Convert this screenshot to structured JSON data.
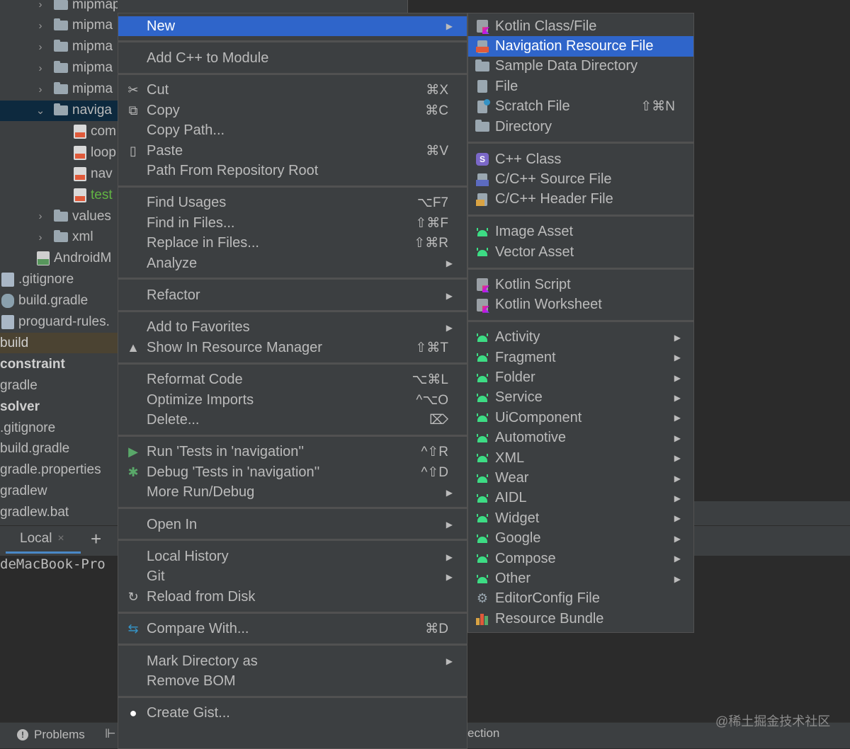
{
  "project_tree": {
    "items": [
      {
        "label": "mipmap-hdpi",
        "kind": "folder",
        "indent": 1,
        "chevron": "›"
      },
      {
        "label": "mipma",
        "kind": "folder",
        "indent": 1,
        "chevron": "›"
      },
      {
        "label": "mipma",
        "kind": "folder",
        "indent": 1,
        "chevron": "›"
      },
      {
        "label": "mipma",
        "kind": "folder",
        "indent": 1,
        "chevron": "›"
      },
      {
        "label": "mipma",
        "kind": "folder",
        "indent": 1,
        "chevron": "›"
      },
      {
        "label": "naviga",
        "kind": "folder",
        "indent": 1,
        "chevron": "⌄",
        "selected": true
      },
      {
        "label": "com",
        "kind": "xml",
        "indent": 2
      },
      {
        "label": "loop",
        "kind": "xml",
        "indent": 2
      },
      {
        "label": "nav",
        "kind": "xml",
        "indent": 2
      },
      {
        "label": "test",
        "kind": "xml",
        "indent": 2,
        "green": true
      },
      {
        "label": "values",
        "kind": "folder",
        "indent": 1,
        "chevron": "›"
      },
      {
        "label": "xml",
        "kind": "folder",
        "indent": 1,
        "chevron": "›"
      },
      {
        "label": "AndroidM",
        "kind": "mf",
        "indent": 3
      },
      {
        "label": ".gitignore",
        "kind": "plain",
        "indent": 0
      },
      {
        "label": "build.gradle",
        "kind": "gradle",
        "indent": 0
      },
      {
        "label": "proguard-rules.",
        "kind": "plain",
        "indent": 0
      },
      {
        "label": "build",
        "kind": "none",
        "indent": -1,
        "build": true
      },
      {
        "label": "constraint",
        "kind": "none",
        "indent": -1,
        "bold": true
      },
      {
        "label": "gradle",
        "kind": "none",
        "indent": -1
      },
      {
        "label": "solver",
        "kind": "none",
        "indent": -1,
        "bold": true
      },
      {
        "label": ".gitignore",
        "kind": "none",
        "indent": -1
      },
      {
        "label": "build.gradle",
        "kind": "none",
        "indent": -1
      },
      {
        "label": "gradle.properties",
        "kind": "none",
        "indent": -1
      },
      {
        "label": "gradlew",
        "kind": "none",
        "indent": -1
      },
      {
        "label": "gradlew.bat",
        "kind": "none",
        "indent": -1
      }
    ]
  },
  "terminal": {
    "tab_label": "Local",
    "close_glyph": "×",
    "add_glyph": "+",
    "prompt_text": "deMacBook-Pro"
  },
  "status_bar": {
    "problems_label": "Problems",
    "problems_icon": "!",
    "separator": "⊩",
    "right_text": "ection"
  },
  "watermark": "@稀土掘金技术社区",
  "context_menu": {
    "items": [
      {
        "label": "New",
        "arrow": "▶",
        "highlighted": true
      },
      {
        "sep": true
      },
      {
        "label": "Add C++ to Module"
      },
      {
        "sep": true
      },
      {
        "label": "Cut",
        "shortcut": "⌘X",
        "icon": "✂",
        "icon_name": "scissors-icon"
      },
      {
        "label": "Copy",
        "shortcut": "⌘C",
        "icon": "⧉",
        "icon_name": "copy-icon"
      },
      {
        "label": "Copy Path..."
      },
      {
        "label": "Paste",
        "shortcut": "⌘V",
        "icon": "▯",
        "icon_name": "clipboard-icon"
      },
      {
        "label": "Path From Repository Root"
      },
      {
        "sep": true
      },
      {
        "label": "Find Usages",
        "shortcut": "⌥F7"
      },
      {
        "label": "Find in Files...",
        "shortcut": "⇧⌘F"
      },
      {
        "label": "Replace in Files...",
        "shortcut": "⇧⌘R"
      },
      {
        "label": "Analyze",
        "arrow": "▶"
      },
      {
        "sep": true
      },
      {
        "label": "Refactor",
        "arrow": "▶"
      },
      {
        "sep": true
      },
      {
        "label": "Add to Favorites",
        "arrow": "▶"
      },
      {
        "label": "Show In Resource Manager",
        "shortcut": "⇧⌘T",
        "icon": "▲",
        "icon_name": "resource-manager-icon"
      },
      {
        "sep": true
      },
      {
        "label": "Reformat Code",
        "shortcut": "⌥⌘L"
      },
      {
        "label": "Optimize Imports",
        "shortcut": "^⌥O"
      },
      {
        "label": "Delete...",
        "shortcut": "⌦"
      },
      {
        "sep": true
      },
      {
        "label": "Run 'Tests in 'navigation''",
        "shortcut": "^⇧R",
        "icon": "▶",
        "icon_name": "run-icon",
        "icon_color": "#59a869"
      },
      {
        "label": "Debug 'Tests in 'navigation''",
        "shortcut": "^⇧D",
        "icon": "✱",
        "icon_name": "debug-icon",
        "icon_color": "#59a869"
      },
      {
        "label": "More Run/Debug",
        "arrow": "▶"
      },
      {
        "sep": true
      },
      {
        "label": "Open In",
        "arrow": "▶"
      },
      {
        "sep": true
      },
      {
        "label": "Local History",
        "arrow": "▶"
      },
      {
        "label": "Git",
        "arrow": "▶"
      },
      {
        "label": "Reload from Disk",
        "icon": "↻",
        "icon_name": "reload-icon"
      },
      {
        "sep": true
      },
      {
        "label": "Compare With...",
        "shortcut": "⌘D",
        "icon": "⇆",
        "icon_name": "compare-icon",
        "icon_color": "#3592c4"
      },
      {
        "sep": true
      },
      {
        "label": "Mark Directory as",
        "arrow": "▶"
      },
      {
        "label": "Remove BOM"
      },
      {
        "sep": true
      },
      {
        "label": "Create Gist...",
        "icon": "●",
        "icon_name": "github-icon",
        "icon_color": "#ffffff"
      }
    ]
  },
  "new_submenu": {
    "items": [
      {
        "label": "Kotlin Class/File",
        "icon": "kotlin"
      },
      {
        "label": "Navigation Resource File",
        "icon": "nav",
        "highlighted": true
      },
      {
        "label": "Sample Data Directory",
        "icon": "folder"
      },
      {
        "label": "File",
        "icon": "file"
      },
      {
        "label": "Scratch File",
        "icon": "scratch",
        "shortcut": "⇧⌘N"
      },
      {
        "label": "Directory",
        "icon": "folder"
      },
      {
        "sep": true
      },
      {
        "label": "C++ Class",
        "icon": "cpp",
        "badge": "S"
      },
      {
        "label": "C/C++ Source File",
        "icon": "src"
      },
      {
        "label": "C/C++ Header File",
        "icon": "hdr"
      },
      {
        "sep": true
      },
      {
        "label": "Image Asset",
        "icon": "android"
      },
      {
        "label": "Vector Asset",
        "icon": "android"
      },
      {
        "sep": true
      },
      {
        "label": "Kotlin Script",
        "icon": "kotlin"
      },
      {
        "label": "Kotlin Worksheet",
        "icon": "kotlin"
      },
      {
        "sep": true
      },
      {
        "label": "Activity",
        "icon": "android",
        "arrow": "▶"
      },
      {
        "label": "Fragment",
        "icon": "android",
        "arrow": "▶"
      },
      {
        "label": "Folder",
        "icon": "android",
        "arrow": "▶"
      },
      {
        "label": "Service",
        "icon": "android",
        "arrow": "▶"
      },
      {
        "label": "UiComponent",
        "icon": "android",
        "arrow": "▶"
      },
      {
        "label": "Automotive",
        "icon": "android",
        "arrow": "▶"
      },
      {
        "label": "XML",
        "icon": "android",
        "arrow": "▶"
      },
      {
        "label": "Wear",
        "icon": "android",
        "arrow": "▶"
      },
      {
        "label": "AIDL",
        "icon": "android",
        "arrow": "▶"
      },
      {
        "label": "Widget",
        "icon": "android",
        "arrow": "▶"
      },
      {
        "label": "Google",
        "icon": "android",
        "arrow": "▶"
      },
      {
        "label": "Compose",
        "icon": "android",
        "arrow": "▶"
      },
      {
        "label": "Other",
        "icon": "android",
        "arrow": "▶"
      },
      {
        "label": "EditorConfig File",
        "icon": "gear",
        "glyph": "⚙"
      },
      {
        "label": "Resource Bundle",
        "icon": "bundle"
      }
    ]
  },
  "colors": {
    "highlight": "#2f65ca",
    "menu_bg": "#3c3f41",
    "android_green": "#3ddc84"
  }
}
